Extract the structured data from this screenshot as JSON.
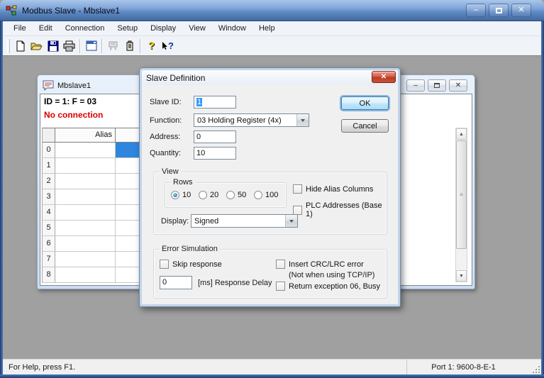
{
  "titlebar": {
    "title": "Modbus Slave - Mbslave1",
    "minimize": "–",
    "close": "✕"
  },
  "menu": {
    "items": [
      "File",
      "Edit",
      "Connection",
      "Setup",
      "Display",
      "View",
      "Window",
      "Help"
    ]
  },
  "toolbar": {
    "icons": [
      "new-file",
      "open-file",
      "save-file",
      "print",
      "display-setup",
      "connection-setup-disabled",
      "slave-definition",
      "help",
      "context-help"
    ],
    "help_glyph": "?",
    "context_help_glyph": "?"
  },
  "doc_window": {
    "title": "Mbslave1",
    "status_line1": "ID = 1: F = 03",
    "status_line2": "No connection",
    "minimize": "–",
    "close": "✕",
    "grid": {
      "alias_header": "Alias",
      "row_labels": [
        "0",
        "1",
        "2",
        "3",
        "4",
        "5",
        "6",
        "7",
        "8"
      ]
    },
    "scrollbar": {
      "up": "▲",
      "down": "▼",
      "grip": "≡"
    }
  },
  "dialog": {
    "title": "Slave Definition",
    "close": "✕",
    "slave_id": {
      "label": "Slave ID:",
      "value": "1"
    },
    "function": {
      "label": "Function:",
      "value": "03 Holding Register (4x)"
    },
    "address": {
      "label": "Address:",
      "value": "0"
    },
    "quantity": {
      "label": "Quantity:",
      "value": "10"
    },
    "ok_label": "OK",
    "cancel_label": "Cancel",
    "view": {
      "label": "View",
      "rows": {
        "label": "Rows",
        "options": [
          {
            "label": "10",
            "selected": true
          },
          {
            "label": "20",
            "selected": false
          },
          {
            "label": "50",
            "selected": false
          },
          {
            "label": "100",
            "selected": false
          }
        ]
      },
      "hide_alias": "Hide Alias Columns",
      "plc_addresses": "PLC Addresses (Base 1)",
      "display": {
        "label": "Display:",
        "value": "Signed"
      }
    },
    "error_simulation": {
      "label": "Error Simulation",
      "skip_response": "Skip response",
      "response_delay": {
        "value": "0",
        "label": "[ms] Response Delay"
      },
      "insert_crc": "Insert CRC/LRC error",
      "insert_crc_note": "(Not when using TCP/IP)",
      "return_exception": "Return exception 06, Busy"
    }
  },
  "statusbar": {
    "left": "For Help, press F1.",
    "right": "Port 1: 9600-8-E-1"
  },
  "colors": {
    "titlebar_blue": "#5c87c2",
    "mdi_background": "#a0a0a0",
    "selected_cell_blue": "#2e86de",
    "no_connection_red": "#d90000",
    "selection_highlight": "#3399ff",
    "ok_glow_blue": "#8ab4dd",
    "dialog_close_red": "#bf3a21"
  }
}
